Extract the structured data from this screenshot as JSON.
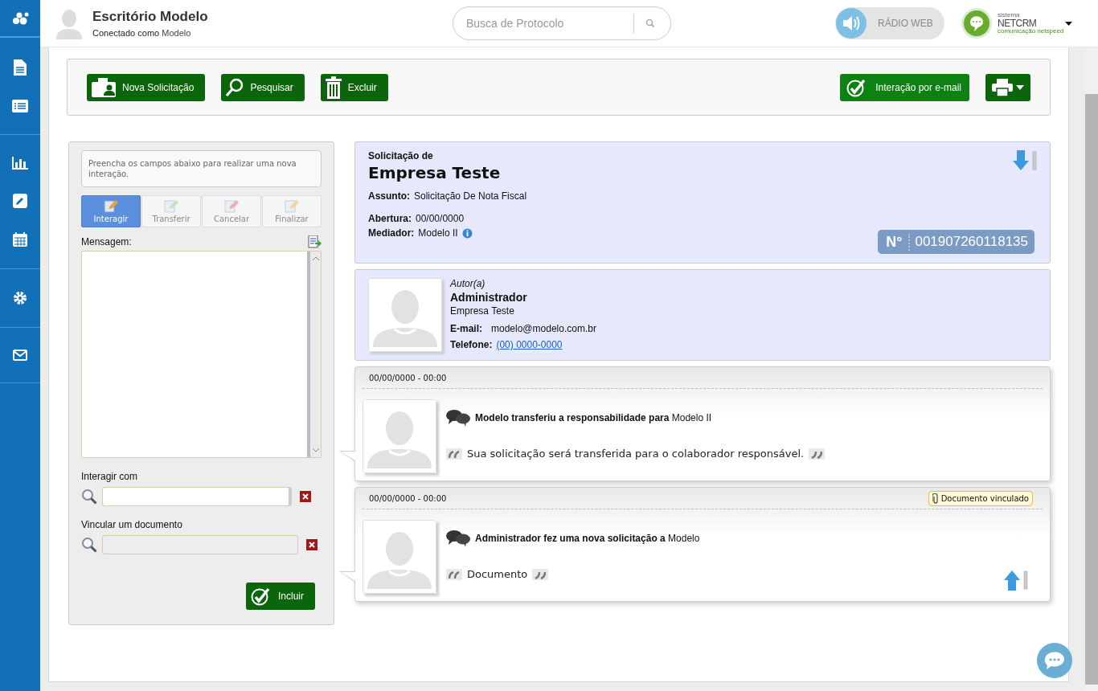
{
  "header": {
    "title": "Escritório Modelo",
    "connected_label": "Conectado como",
    "user": "Modelo"
  },
  "search": {
    "placeholder": "Busca de Protocolo"
  },
  "radio": {
    "label": "RÁDIO WEB",
    "on": false
  },
  "brand": {
    "small": "sistema",
    "name": "NETCRM",
    "tagline": "comunicação netspeed"
  },
  "toolbar": {
    "left_buttons": [
      {
        "label": "Nova Solicitação"
      },
      {
        "label": "Pesquisar"
      },
      {
        "label": "Excluir"
      }
    ],
    "email_button": "Interação por e-mail"
  },
  "form": {
    "hint": "Preencha os campos abaixo para realizar uma nova interação.",
    "tabs": [
      {
        "label": "Interagir",
        "selected": true,
        "disabled": false
      },
      {
        "label": "Transferir",
        "selected": false,
        "disabled": true
      },
      {
        "label": "Cancelar",
        "selected": false,
        "disabled": true
      },
      {
        "label": "Finalizar",
        "selected": false,
        "disabled": true
      }
    ],
    "message_label": "Mensagem:",
    "fields": [
      {
        "label": "Interagir com",
        "disabled": false
      },
      {
        "label": "Vincular um documento",
        "disabled": true
      }
    ],
    "submit": "Incluir"
  },
  "request": {
    "intro": "Solicitação de",
    "company": "Empresa Teste",
    "subject_label": "Assunto:",
    "subject": "Solicitação De Nota Fiscal",
    "opened_label": "Abertura:",
    "opened": "00/00/0000",
    "mediator_label": "Mediador:",
    "mediator": "Modelo II",
    "number_label": "N°",
    "number": "001907260118135"
  },
  "author": {
    "role": "Autor(a)",
    "name": "Administrador",
    "company": "Empresa Teste",
    "email_label": "E-mail:",
    "email": "modelo@modelo.com.br",
    "phone_label": "Telefone:",
    "phone": "(00) 0000-0000"
  },
  "timeline": [
    {
      "date": "00/00/0000 - 00:00",
      "text": "**Modelo transferiu a responsabilidade para** Modelo II",
      "quote": "Sua solicitação será transferida para o colaborador responsável.",
      "scroll_up": false
    },
    {
      "date": "00/00/0000 - 00:00",
      "attachment": "Documento vinculado",
      "text": "**Administrador fez uma nova solicitação a** Modelo",
      "quote": "Documento",
      "scroll_up": true
    }
  ]
}
